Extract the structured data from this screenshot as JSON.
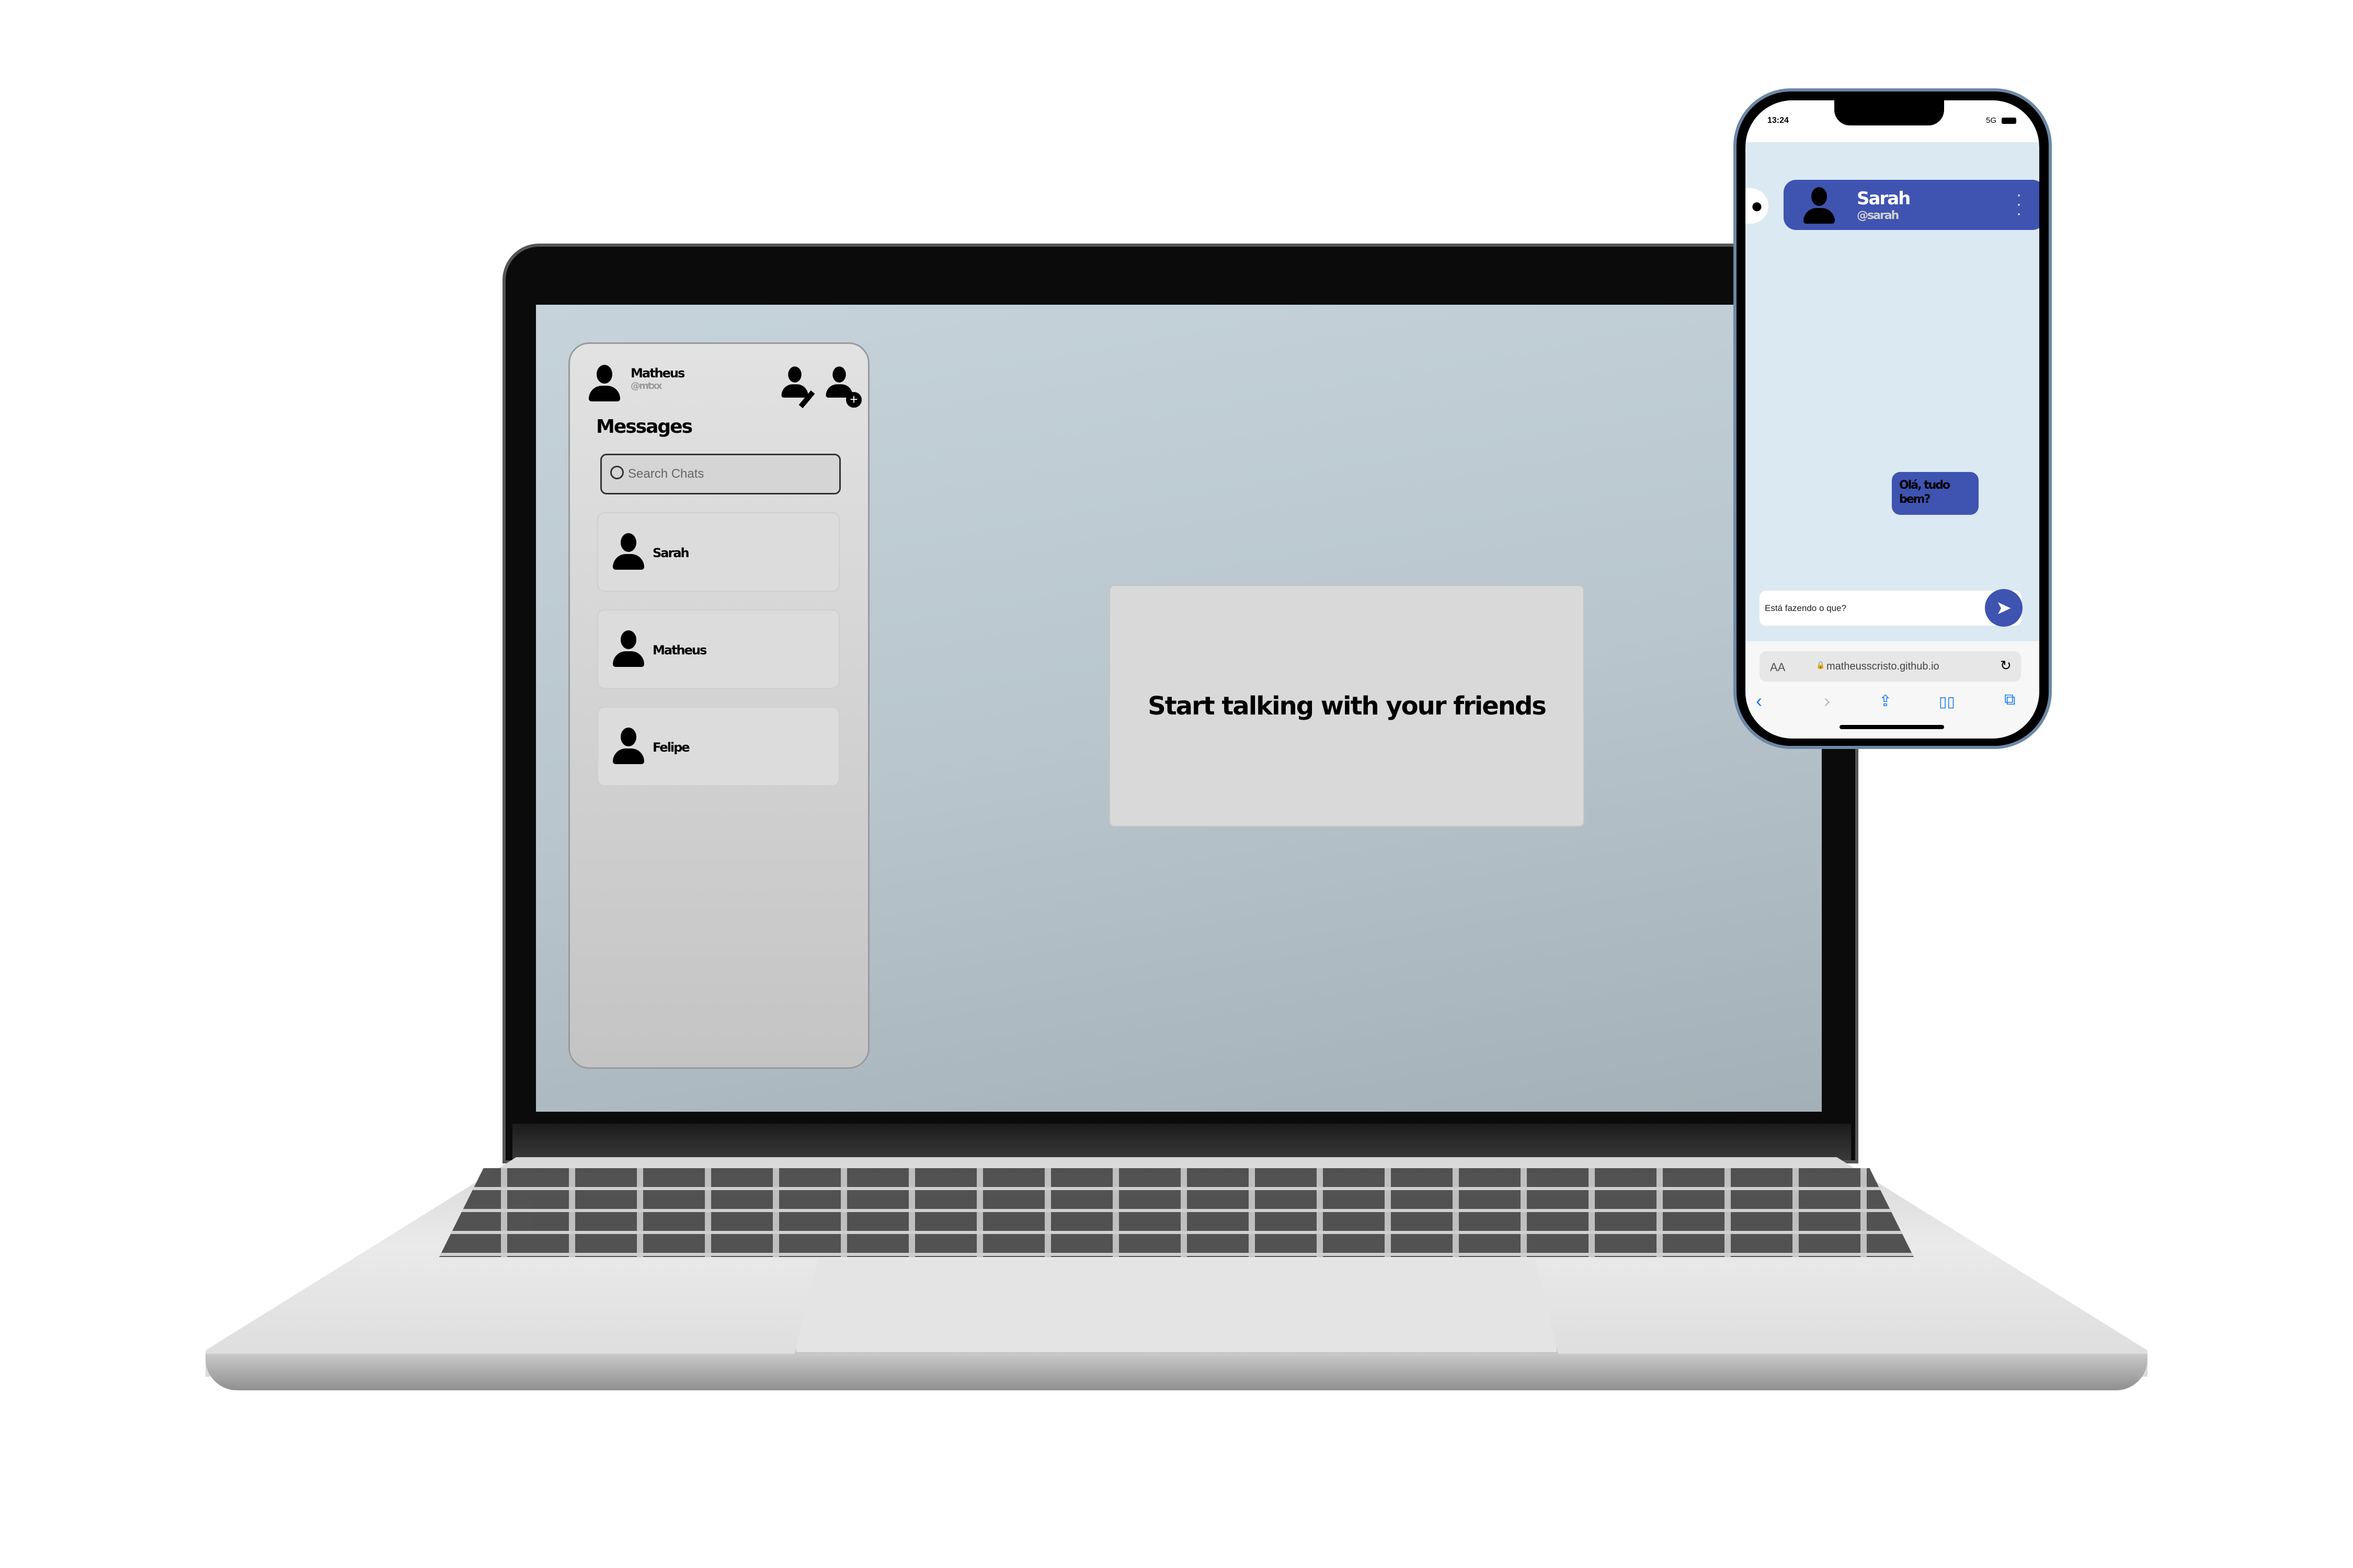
{
  "laptop": {
    "sidebar": {
      "user_name": "Matheus",
      "user_handle": "@mtxx",
      "title": "Messages",
      "search_placeholder": "Search Chats",
      "chats": [
        {
          "name": "Sarah"
        },
        {
          "name": "Matheus"
        },
        {
          "name": "Felipe"
        }
      ]
    },
    "main": {
      "empty_message": "Start talking with your friends"
    }
  },
  "phone": {
    "status": {
      "time": "13:24",
      "network": "5G"
    },
    "chat_header": {
      "name": "Sarah",
      "handle": "@sarah"
    },
    "messages": [
      {
        "text": "Olá, tudo bem?"
      }
    ],
    "input_value": "Está fazendo o que?",
    "browser": {
      "text_size": "AA",
      "url": "matheusscristo.github.io"
    },
    "colors": {
      "accent": "#3f53b1",
      "chat_bg": "#dbe9f3",
      "safari_blue": "#1a7cf0"
    }
  }
}
